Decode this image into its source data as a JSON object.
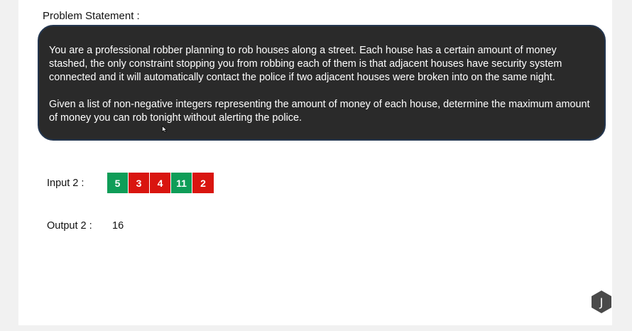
{
  "heading": "Problem Statement :",
  "problem": {
    "paragraph1": "You are a professional robber planning to rob houses along a street. Each house has a certain amount of money stashed, the only constraint stopping you from robbing each of them is that adjacent houses have security system connected and it will automatically contact the police if two adjacent houses were broken into on the same night.",
    "paragraph2": "Given a list of non-negative integers representing the amount of money of each house, determine the maximum amount of money you can rob tonight without alerting the police."
  },
  "input": {
    "label": "Input 2 :",
    "houses": [
      {
        "value": "5",
        "color": "#0f9d58"
      },
      {
        "value": "3",
        "color": "#d9150f"
      },
      {
        "value": "4",
        "color": "#d9150f"
      },
      {
        "value": "11",
        "color": "#0f9d58"
      },
      {
        "value": "2",
        "color": "#d9150f"
      }
    ]
  },
  "output": {
    "label": "Output 2 :",
    "value": "16"
  },
  "avatar": {
    "letter": "J",
    "color": "#4a4a4a"
  }
}
